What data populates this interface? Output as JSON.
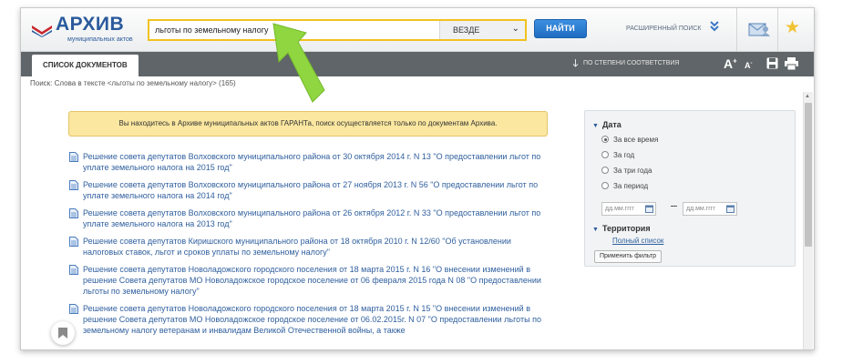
{
  "header": {
    "logo_title": "АРХИВ",
    "logo_subtitle": "муниципальных актов",
    "search_value": "льготы по земельному налогу",
    "scope_selected": "ВЕЗДЕ",
    "find_label": "НАЙТИ",
    "advanced_search_label": "РАСШИРЕННЫЙ ПОИСК"
  },
  "toolbar": {
    "tab_label": "СПИСОК ДОКУМЕНТОВ",
    "sort_label": "ПО СТЕПЕНИ СООТВЕТСТВИЯ",
    "font_up": "A",
    "font_up_sign": "+",
    "font_down": "A",
    "font_down_sign": "-"
  },
  "query_line": "Поиск: Слова в тексте <льготы по земельному налогу> (165)",
  "notice": "Вы находитесь в Архиве муниципальных актов ГАРАНТа, поиск осуществляется только по документам Архива.",
  "results": [
    "Решение совета депутатов Волховского муниципального района от 30 октября 2014 г. N 13 \"О предоставлении льгот по уплате земельного налога на 2015 год\"",
    "Решение совета депутатов Волховского муниципального района от 27 ноября 2013 г. N 56 \"О предоставлении льгот по уплате земельного налога на 2014 год\"",
    "Решение совета депутатов Волховского муниципального района от 26 октября 2012 г. N 33 \"О предоставлении льгот по уплате земельного налога на 2013 год\"",
    "Решение совета депутатов Киришского муниципального района от 18 октября 2010 г. N 12/60 \"Об установлении налоговых ставок, льгот и сроков уплаты по земельному налогу\"",
    "Решение совета депутатов Новоладожского городского поселения от 18 марта 2015 г. N 16 \"О внесении изменений в решение Совета депутатов МО Новоладожское городское поселение от 06 февраля 2015 года N 08 \"О предоставлении льготы по земельному налогу\"",
    "Решение совета депутатов Новоладожского городского поселения от 18 марта 2015 г. N 15 \"О внесении изменений в решение Совета депутатов МО Новоладожское городское поселение от 06.02.2015г. N 07 \"О предоставлении льготы по земельному налогу ветеранам и инвалидам Великой Отечественной войны, а также"
  ],
  "filter": {
    "date_heading": "Дата",
    "options": [
      "За все время",
      "За год",
      "За три года",
      "За период"
    ],
    "selected_option": "За все время",
    "date_placeholder": "дд.мм.гггг",
    "territory_heading": "Территория",
    "full_list_link": "Полный список",
    "apply_label": "Применить фильтр"
  },
  "colors": {
    "brand_blue": "#2a5a9c",
    "search_border": "#f2c21e",
    "toolbar_bg": "#5f6568",
    "notice_bg": "#fbe7a0",
    "link_blue": "#2f5f9e",
    "annotation_arrow": "#8fd640"
  },
  "icons": {
    "logo": "logo-mark-icon",
    "scope_caret": "chevron-down-icon",
    "advanced": "double-chevron-down-icon",
    "mail": "mail-user-icon",
    "favorite": "star-icon",
    "sort": "arrow-down-icon",
    "save": "save-icon",
    "print": "printer-icon",
    "document": "document-icon",
    "calendar": "calendar-icon",
    "bookmark": "bookmark-icon",
    "overlay": "green-arrow-icon"
  }
}
